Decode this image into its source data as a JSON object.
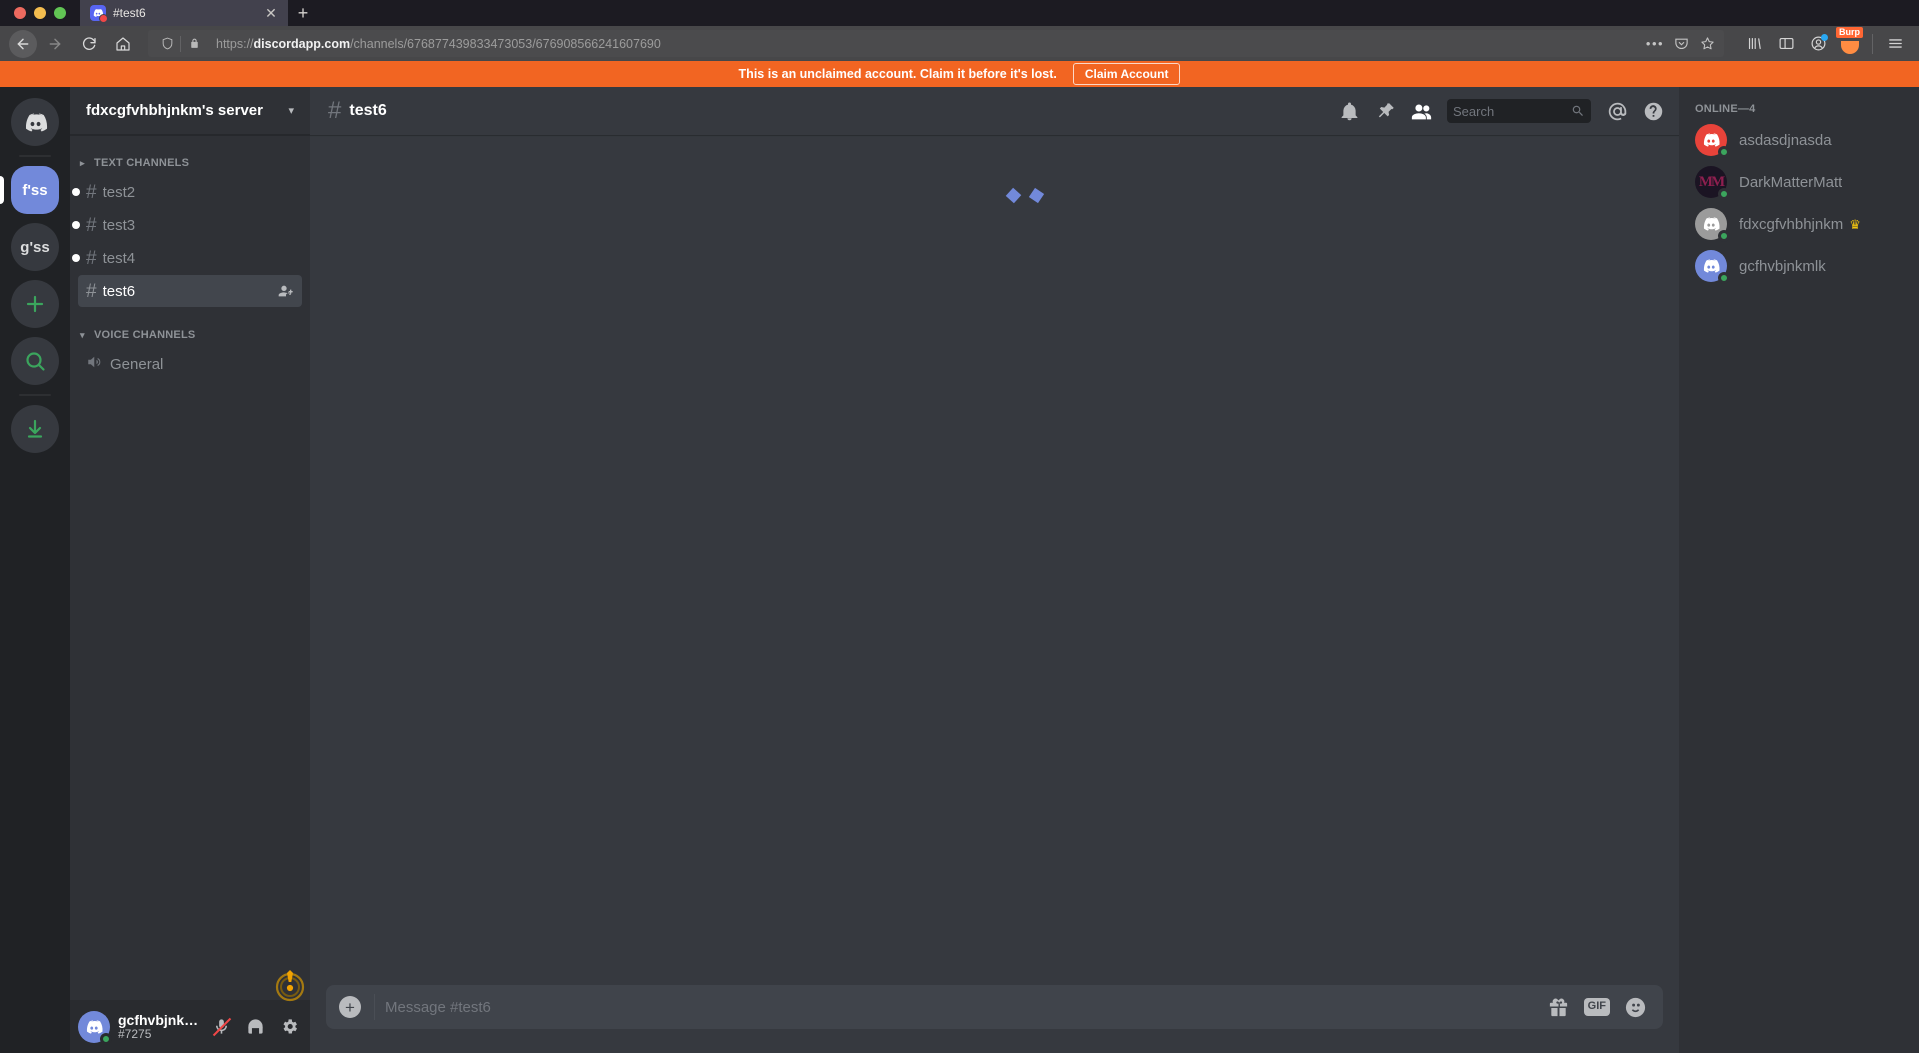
{
  "browser": {
    "tab": {
      "title": "#test6",
      "close_label": "✕"
    },
    "newtab_label": "+",
    "url": {
      "scheme": "https://",
      "domain": "discordapp.com",
      "path": "/channels/676877439833473053/676908566241607690"
    },
    "icons": {
      "back": "back-arrow-icon",
      "forward": "forward-arrow-icon",
      "reload": "reload-icon",
      "home": "home-icon",
      "shield": "tracking-protection-shield-icon",
      "lock": "padlock-icon",
      "page_actions": "•••",
      "pocket": "pocket-icon",
      "bookmark": "star-icon",
      "library": "library-icon",
      "sidebar": "sidebar-icon",
      "account": "account-icon",
      "burp": "Burp",
      "menu": "hamburger-menu-icon"
    }
  },
  "banner": {
    "message": "This is an unclaimed account. Claim it before it's lost.",
    "button_label": "Claim Account",
    "color": "#f26522"
  },
  "guild_rail": {
    "home_label": "discord-home",
    "guilds": [
      {
        "label": "f'ss",
        "active": true
      },
      {
        "label": "g'ss",
        "active": false
      }
    ],
    "add_server_label": "+",
    "explore_label": "search-icon",
    "download_label": "download-icon"
  },
  "sidebar": {
    "server_name": "fdxcgfvhbhjnkm's server",
    "categories": [
      {
        "label": "TEXT CHANNELS",
        "collapsed": true,
        "channels": [
          {
            "name": "test2",
            "unread": true,
            "active": false
          },
          {
            "name": "test3",
            "unread": true,
            "active": false
          },
          {
            "name": "test4",
            "unread": true,
            "active": false
          },
          {
            "name": "test6",
            "unread": false,
            "active": true
          }
        ]
      },
      {
        "label": "VOICE CHANNELS",
        "collapsed": false,
        "channels": [
          {
            "name": "General",
            "unread": false,
            "active": false
          }
        ]
      }
    ]
  },
  "user_panel": {
    "username": "gcfhvbjnkmlk",
    "discriminator": "#7275",
    "status": "online",
    "avatar_color": "#7289da",
    "mic_muted": true,
    "icons": {
      "mic": "microphone-muted-icon",
      "headset": "headphones-icon",
      "settings": "gear-icon"
    },
    "warning_icon": "warning-exclamation-icon"
  },
  "channel_header": {
    "hash": "#",
    "name": "test6",
    "icons": {
      "notifications": "bell-icon",
      "pinned": "pin-icon",
      "members": "members-icon",
      "mentions": "at-mention-icon",
      "help": "help-question-icon"
    }
  },
  "search": {
    "placeholder": "Search",
    "value": "",
    "icon": "search-icon"
  },
  "chat": {
    "loading": true,
    "loading_label": "loading-spinner"
  },
  "composer": {
    "placeholder": "Message #test6",
    "value": "",
    "attach_label": "+",
    "gift_icon": "gift-icon",
    "gif_label": "GIF",
    "emoji_icon": "emoji-smiley-icon"
  },
  "members": {
    "heading": "ONLINE—4",
    "count": 4,
    "list": [
      {
        "name": "asdasdjnasda",
        "avatar_color": "#e8433a",
        "status": "online",
        "owner": false,
        "avatar_type": "discord-mark"
      },
      {
        "name": "DarkMatterMatt",
        "avatar_color": "#1b1423",
        "status": "online",
        "owner": false,
        "avatar_type": "mm-logo",
        "initials": "MM"
      },
      {
        "name": "fdxcgfvhbhjnkm",
        "avatar_color": "#9b9b9b",
        "status": "online",
        "owner": true,
        "avatar_type": "discord-mark",
        "crown": "♛"
      },
      {
        "name": "gcfhvbjnkmlk",
        "avatar_color": "#7289da",
        "status": "online",
        "owner": false,
        "avatar_type": "discord-mark"
      }
    ]
  }
}
